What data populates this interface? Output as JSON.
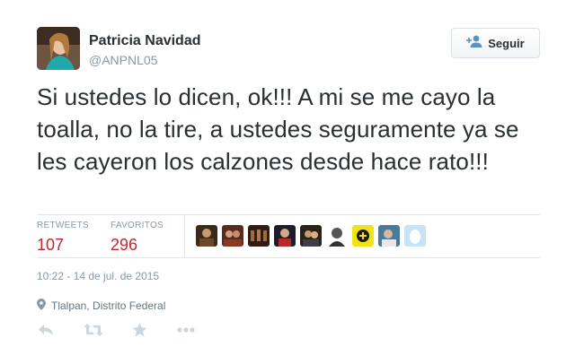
{
  "user": {
    "name": "Patricia Navidad",
    "handle": "@ANPNL05"
  },
  "follow_button": {
    "label": "Seguir",
    "icon": "add-user-icon"
  },
  "tweet": {
    "text": "Si ustedes lo dicen, ok!!! A mi se me cayo la toalla, no la tire, a ustedes seguramente ya se les cayeron los calzones desde hace rato!!!"
  },
  "stats": {
    "retweets_label": "RETWEETS",
    "retweets_count": "107",
    "favorites_label": "FAVORITOS",
    "favorites_count": "296"
  },
  "favoriters": [
    "avatar-1",
    "avatar-2",
    "avatar-3",
    "avatar-4",
    "avatar-5",
    "avatar-6",
    "avatar-7",
    "avatar-8",
    "avatar-9"
  ],
  "timestamp": "10:22 - 14 de jul. de 2015",
  "location": "Tlalpan, Distrito Federal",
  "actions": [
    "reply-icon",
    "retweet-icon",
    "favorite-icon",
    "more-icon"
  ],
  "colors": {
    "count_red": "#c0272d",
    "muted_text": "#8899a6",
    "body_text": "#292f33",
    "border": "#e1e8ed"
  }
}
